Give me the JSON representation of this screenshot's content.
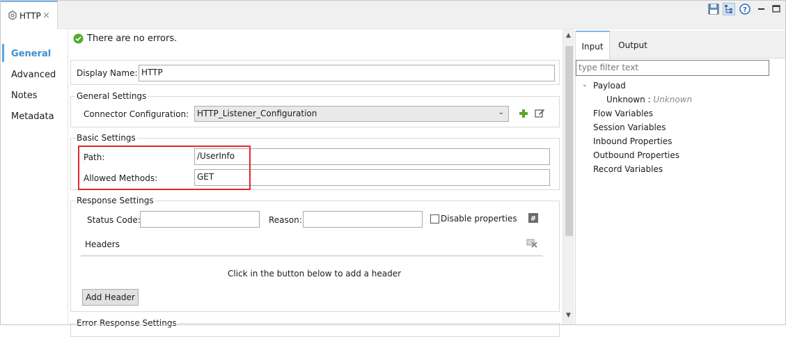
{
  "editor_tab": {
    "title": "HTTP",
    "close_symbol": "×"
  },
  "toolbar": {
    "icons": [
      "save-icon",
      "tree-view-icon",
      "help-icon",
      "minimize-icon",
      "maximize-icon"
    ]
  },
  "left_nav": {
    "items": [
      {
        "label": "General",
        "active": true
      },
      {
        "label": "Advanced",
        "active": false
      },
      {
        "label": "Notes",
        "active": false
      },
      {
        "label": "Metadata",
        "active": false
      }
    ],
    "active_color": "#3d8fd1"
  },
  "status": {
    "text": "There are no errors.",
    "icon": "check-circle-icon",
    "color": "#4caf2c"
  },
  "display_name": {
    "label": "Display Name:",
    "value": "HTTP"
  },
  "general_settings": {
    "title": "General Settings",
    "connector_label": "Connector Configuration:",
    "connector_value": "HTTP_Listener_Configuration"
  },
  "basic_settings": {
    "title": "Basic Settings",
    "path_label": "Path:",
    "path_value": "/UserInfo",
    "methods_label": "Allowed Methods:",
    "methods_value": "GET",
    "highlight_color": "#e3262e"
  },
  "response_settings": {
    "title": "Response Settings",
    "status_code_label": "Status Code:",
    "status_code_value": "",
    "reason_label": "Reason:",
    "reason_value": "",
    "disable_label": "Disable properties",
    "disable_checked": false,
    "headers_label": "Headers",
    "empty_message": "Click in the button below to add a header",
    "add_header_label": "Add Header"
  },
  "error_response_settings": {
    "title": "Error Response Settings"
  },
  "right_panel": {
    "tabs": [
      {
        "label": "Input",
        "active": true
      },
      {
        "label": "Output",
        "active": false
      }
    ],
    "filter_placeholder": "type filter text",
    "tree": {
      "payload": "Payload",
      "payload_child_label": "Unknown :",
      "payload_child_value": "Unknown",
      "items": [
        "Flow Variables",
        "Session Variables",
        "Inbound Properties",
        "Outbound Properties",
        "Record Variables"
      ]
    }
  }
}
